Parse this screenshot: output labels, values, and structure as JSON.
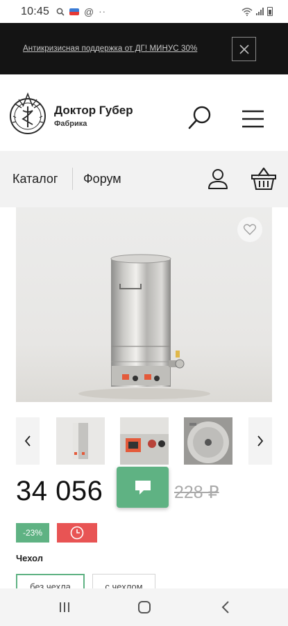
{
  "status_bar": {
    "time": "10:45",
    "notif_icons": [
      "search-icon",
      "news-badge-icon",
      "at-icon",
      "more-dots-icon"
    ],
    "sys_icons": [
      "wifi-icon",
      "signal-icon",
      "battery-icon"
    ]
  },
  "promo": {
    "text": "Антикризисная поддержка от ДГ! МИНУС 30%"
  },
  "header": {
    "brand_name": "Доктор Губер",
    "brand_sub": "Фабрика"
  },
  "nav": {
    "catalog": "Каталог",
    "forum": "Форум"
  },
  "product": {
    "price_current": "34 056",
    "price_old": "228 ₽",
    "discount_badge": "-23%",
    "option_title": "Чехол",
    "options": [
      "без чехла",
      "с чехлом"
    ],
    "thumbnails": [
      "thumbnail-tank",
      "thumbnail-controls",
      "thumbnail-inside"
    ]
  },
  "colors": {
    "accent": "#5fb283",
    "timer": "#e85454",
    "promo_bg": "#141414",
    "nav_bg": "#f2f2f2"
  }
}
